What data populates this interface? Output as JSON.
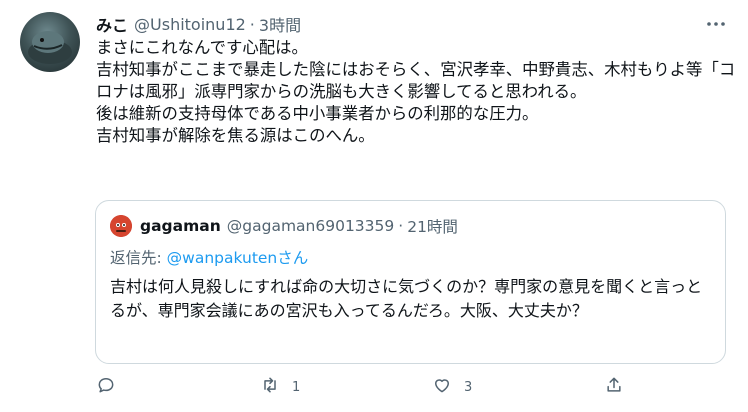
{
  "tweet": {
    "display_name": "みこ",
    "handle": "@Ushitoinu12",
    "separator": "·",
    "time": "3時間",
    "body": "まさにこれなんです心配は。\n吉村知事がここまで暴走した陰にはおそらく、宮沢孝幸、中野貴志、木村もりよ等「コロナは風邪」派専門家からの洗脳も大きく影響してると思われる。\n後は維新の支持母体である中小事業者からの利那的な圧力。\n吉村知事が解除を焦る源はこのへん。"
  },
  "quote": {
    "display_name": "gagaman",
    "handle": "@gagaman69013359",
    "separator": "·",
    "time": "21時間",
    "reply_prefix": "返信先: ",
    "reply_to": "@wanpakutenさん",
    "body": "吉村は何人見殺しにすれば命の大切さに気づくのか？専門家の意見を聞くと言っとるが、専門家会議にあの宮沢も入ってるんだろ。大阪、大丈夫か？"
  },
  "actions": {
    "reply_count": "",
    "retweet_count": "1",
    "like_count": "3"
  },
  "icons": {
    "more": "more-icon",
    "reply": "reply-icon",
    "retweet": "retweet-icon",
    "like": "heart-icon",
    "share": "share-icon"
  },
  "colors": {
    "text": "#0f1419",
    "secondary": "#536471",
    "link": "#1d9bf0",
    "border": "#cfd9de"
  }
}
